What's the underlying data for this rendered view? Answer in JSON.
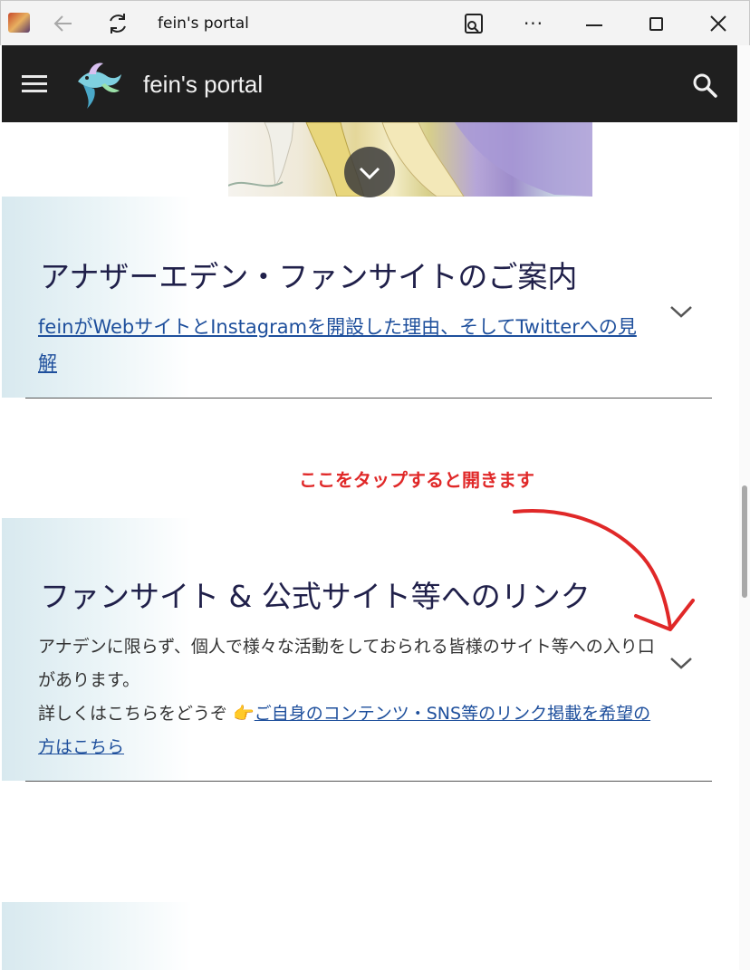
{
  "browser": {
    "tab_title": "fein's portal"
  },
  "header": {
    "site_title": "fein's portal"
  },
  "sections": [
    {
      "title": "アナザーエデン・ファンサイトのご案内",
      "link": "feinがWebサイトとInstagramを開設した理由、そしてTwitterへの見解"
    },
    {
      "title": "ファンサイト & 公式サイト等へのリンク",
      "description": "アナデンに限らず、個人で様々な活動をしておられる皆様のサイト等への入り口があります。",
      "details_prefix": "詳しくはこちらをどうぞ",
      "pointer_emoji": "👉",
      "details_link": "ご自身のコンテンツ・SNS等のリンク掲載を希望の方はこちら"
    }
  ],
  "annotation": {
    "text": "ここをタップすると開きます",
    "color": "#e02828"
  },
  "colors": {
    "header_bg": "#1f1f1f",
    "title_text": "#20204a",
    "link": "#1e4f9c"
  },
  "icons": {
    "menu": "hamburger-icon",
    "search": "search-icon",
    "expand": "chevron-down-icon"
  }
}
